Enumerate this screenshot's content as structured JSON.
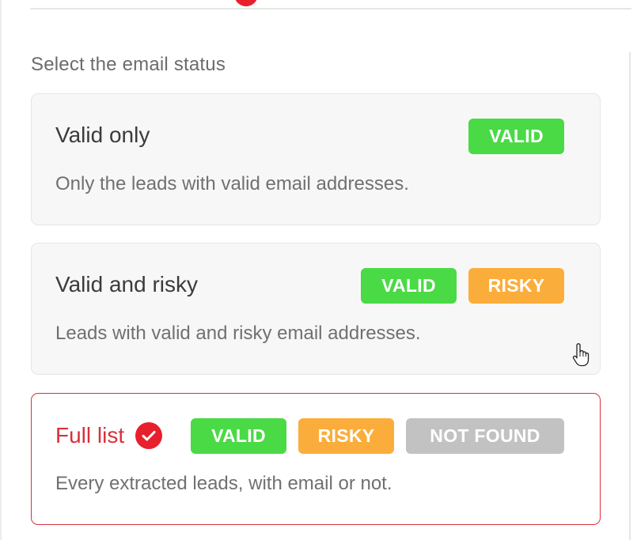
{
  "section_label": "Select the email status",
  "options": [
    {
      "title": "Valid only",
      "description": "Only the leads with valid email addresses.",
      "tags": [
        "VALID"
      ],
      "selected": false
    },
    {
      "title": "Valid and risky",
      "description": "Leads with valid and risky email addresses.",
      "tags": [
        "VALID",
        "RISKY"
      ],
      "selected": false
    },
    {
      "title": "Full list",
      "description": "Every extracted leads, with email or not.",
      "tags": [
        "VALID",
        "RISKY",
        "NOT FOUND"
      ],
      "selected": true
    }
  ],
  "colors": {
    "valid": "#4ada46",
    "risky": "#fbad3b",
    "not_found": "#c2c2c2",
    "accent": "#d9303d"
  },
  "icons": {
    "selected_check": "check-circle-icon",
    "cursor": "hand-pointer-icon"
  }
}
